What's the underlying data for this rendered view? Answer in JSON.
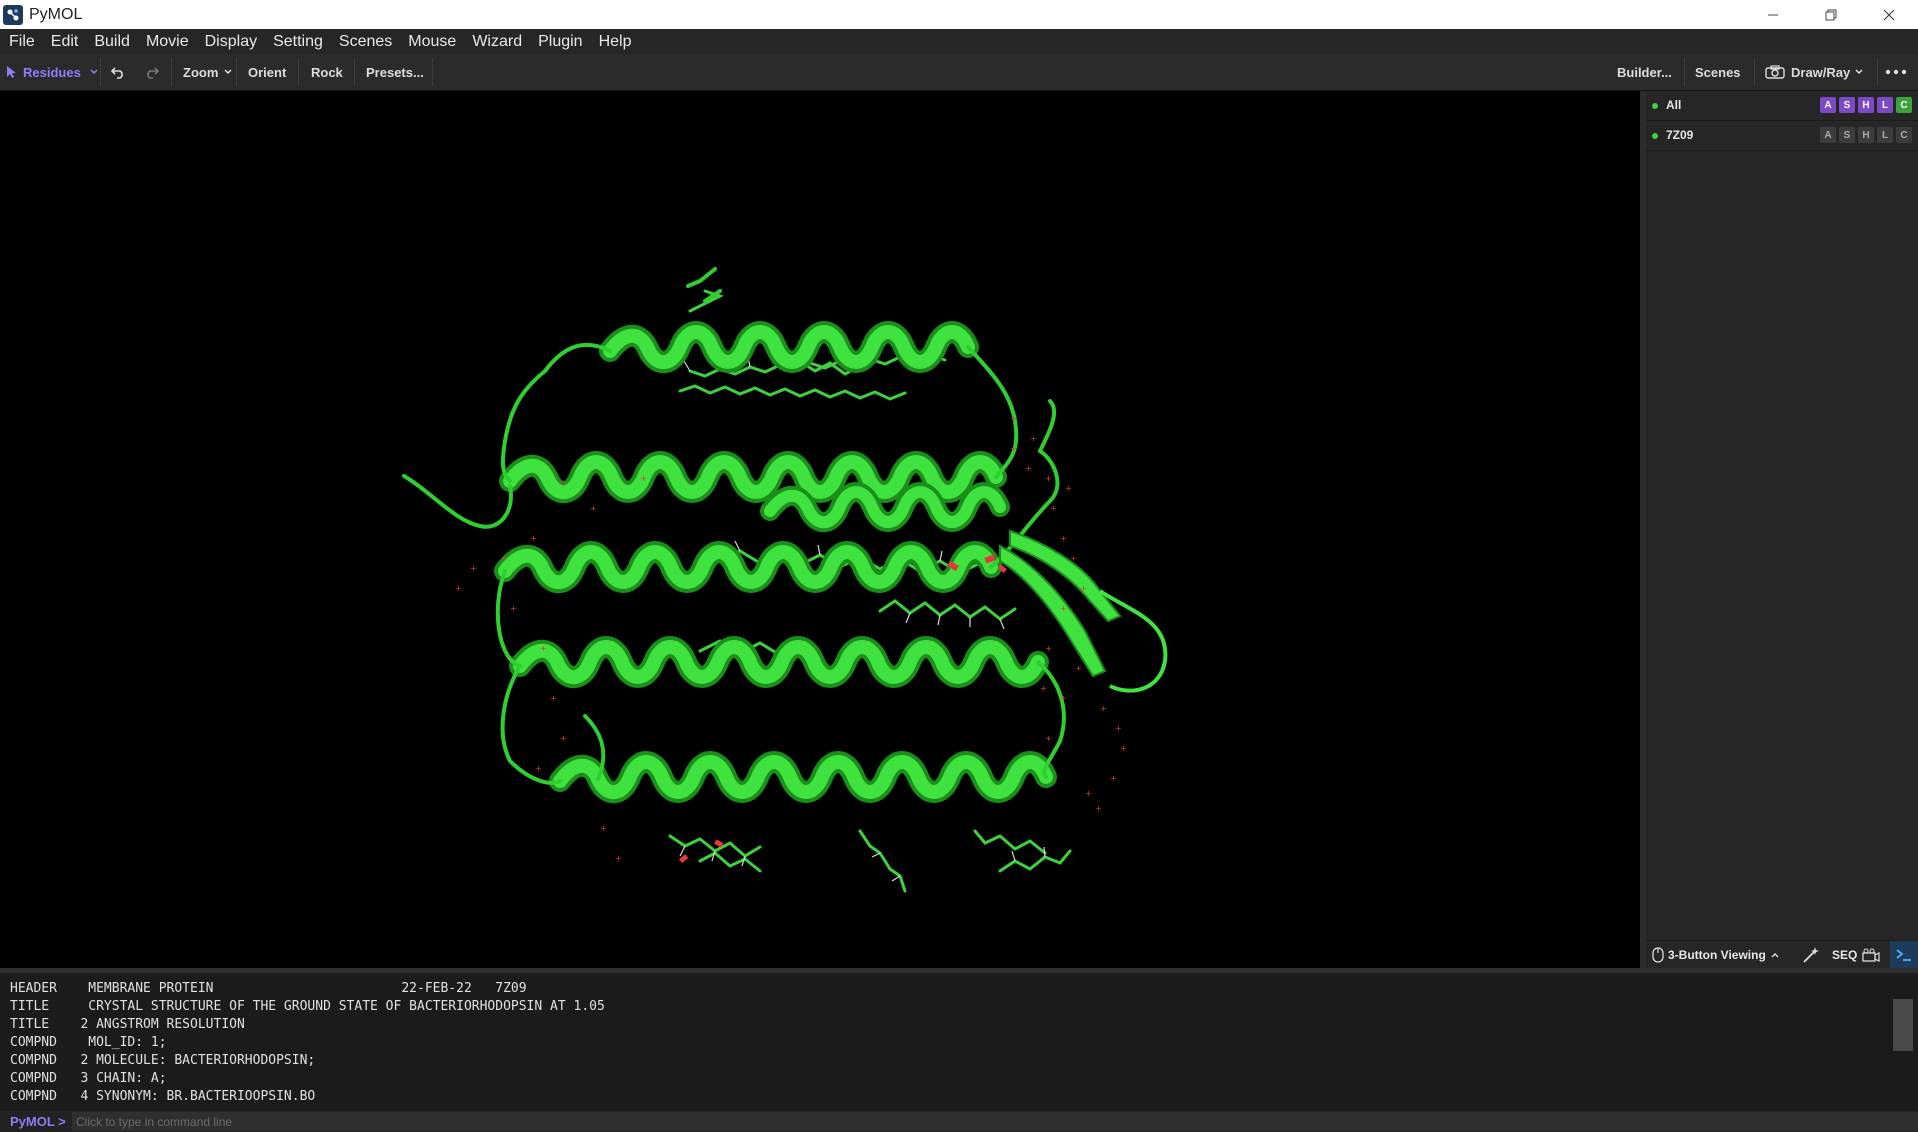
{
  "window": {
    "title": "PyMOL",
    "icon": "pymol-icon"
  },
  "menu": [
    "File",
    "Edit",
    "Build",
    "Movie",
    "Display",
    "Setting",
    "Scenes",
    "Mouse",
    "Wizard",
    "Plugin",
    "Help"
  ],
  "toolbar": {
    "selection_mode": "Residues",
    "zoom": "Zoom",
    "orient": "Orient",
    "rock": "Rock",
    "presets": "Presets...",
    "builder": "Builder...",
    "scenes": "Scenes",
    "draw_ray": "Draw/Ray"
  },
  "objects": [
    {
      "name": "All",
      "enabled": true,
      "buttons": [
        "A",
        "S",
        "H",
        "L",
        "C"
      ]
    },
    {
      "name": "7Z09",
      "enabled": true,
      "buttons": [
        "A",
        "S",
        "H",
        "L",
        "C"
      ]
    }
  ],
  "bottom_panel": {
    "mouse_mode": "3-Button Viewing",
    "seq": "SEQ"
  },
  "console_lines": [
    "HEADER    MEMBRANE PROTEIN                        22-FEB-22   7Z09",
    "TITLE     CRYSTAL STRUCTURE OF THE GROUND STATE OF BACTERIORHODOPSIN AT 1.05",
    "TITLE    2 ANGSTROM RESOLUTION",
    "COMPND    MOL_ID: 1;",
    "COMPND   2 MOLECULE: BACTERIORHODOPSIN;",
    "COMPND   3 CHAIN: A;",
    "COMPND   4 SYNONYM: BR.BACTERIOOPSIN.BO"
  ],
  "command": {
    "prompt": "PyMOL >",
    "placeholder": "Click to type in command line"
  },
  "colors": {
    "cartoon": "#22cc22",
    "oxygen": "#e23a3a",
    "accent_purple": "#8f7cf7",
    "viewer_bg": "#000000"
  }
}
